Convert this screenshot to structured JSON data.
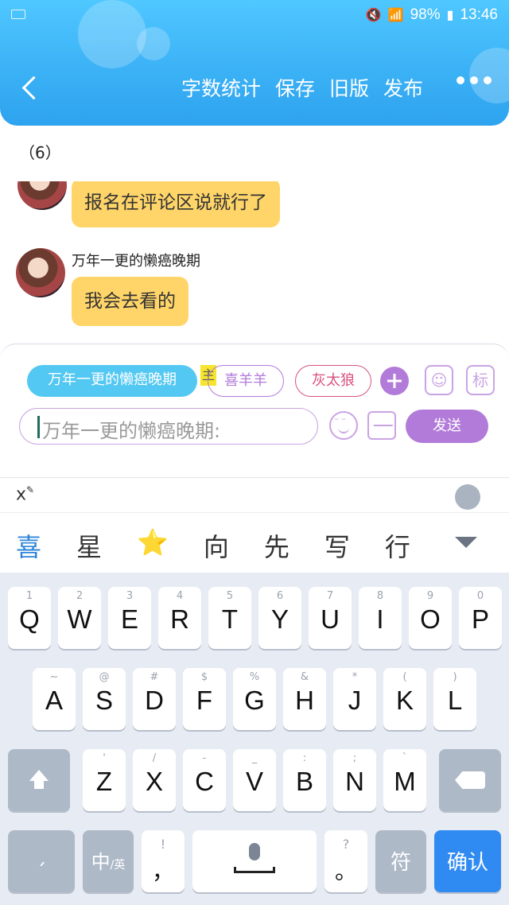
{
  "status_bar": {
    "battery": "98%",
    "time": "13:46"
  },
  "header": {
    "nav_items": [
      "字数统计",
      "保存",
      "旧版",
      "发布"
    ]
  },
  "section_label": "（6）",
  "messages": [
    {
      "name": "",
      "text": "报名在评论区说就行了"
    },
    {
      "name": "万年一更的懒癌晚期",
      "text": "我会去看的"
    }
  ],
  "panel": {
    "roles": [
      "万年一更的懒癌晚期",
      "喜羊羊",
      "灰太狼"
    ],
    "main_tag": "主",
    "icon_labels": [
      "标"
    ],
    "placeholder": "万年一更的懒癌晚期:",
    "send": "发送"
  },
  "keyboard": {
    "top_label": "x",
    "candidates": [
      "喜",
      "星",
      "⭐",
      "向",
      "先",
      "写",
      "行"
    ],
    "row1": [
      {
        "n": "1",
        "c": "Q"
      },
      {
        "n": "2",
        "c": "W"
      },
      {
        "n": "3",
        "c": "E"
      },
      {
        "n": "4",
        "c": "R"
      },
      {
        "n": "5",
        "c": "T"
      },
      {
        "n": "6",
        "c": "Y"
      },
      {
        "n": "7",
        "c": "U"
      },
      {
        "n": "8",
        "c": "I"
      },
      {
        "n": "9",
        "c": "O"
      },
      {
        "n": "0",
        "c": "P"
      }
    ],
    "row2": [
      {
        "n": "~",
        "c": "A"
      },
      {
        "n": "@",
        "c": "S"
      },
      {
        "n": "#",
        "c": "D"
      },
      {
        "n": "$",
        "c": "F"
      },
      {
        "n": "%",
        "c": "G"
      },
      {
        "n": "&",
        "c": "H"
      },
      {
        "n": "*",
        "c": "J"
      },
      {
        "n": "(",
        "c": "K"
      },
      {
        "n": ")",
        "c": "L"
      }
    ],
    "row3": [
      {
        "n": "'",
        "c": "Z"
      },
      {
        "n": "/",
        "c": "X"
      },
      {
        "n": "-",
        "c": "C"
      },
      {
        "n": "_",
        "c": "V"
      },
      {
        "n": ":",
        "c": "B"
      },
      {
        "n": ";",
        "c": "N"
      },
      {
        "n": "`",
        "c": "M"
      }
    ],
    "zh_key": "中",
    "zh_sub": "/英",
    "comma_top": "!",
    "comma": "，",
    "period_top": "?",
    "period": "。",
    "symbols": "符",
    "enter": "确认"
  },
  "colors": {
    "header": "#3ab0f5",
    "bubble": "#ffd569",
    "accent": "#b27bd9",
    "role_active": "#53c8f2",
    "enter": "#2f8bf1"
  }
}
